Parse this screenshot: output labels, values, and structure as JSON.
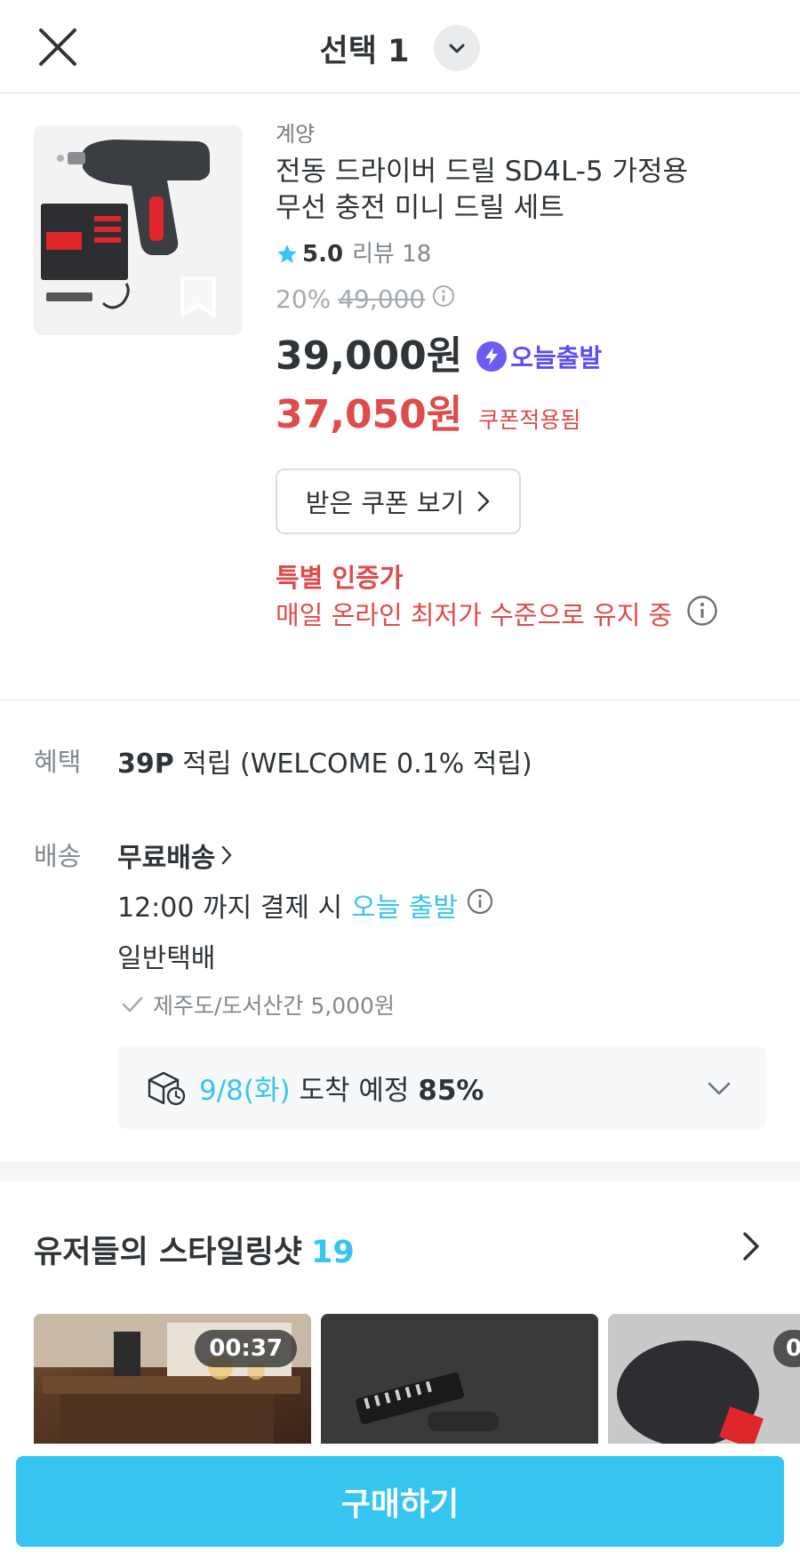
{
  "header": {
    "title": "선택 1",
    "close_icon": "close-icon",
    "dropdown_icon": "chevron-down-icon"
  },
  "product": {
    "brand": "계양",
    "name_line1": "전동 드라이버 드릴 SD4L-5 가정용",
    "name_line2": "무선 충전 미니 드릴 세트",
    "rating": "5.0",
    "review_label": "리뷰 18",
    "discount_rate": "20%",
    "original_price": "49,000",
    "price": "39,000원",
    "badge_today": "오늘출발",
    "coupon_price": "37,050원",
    "coupon_note": "쿠폰적용됨",
    "coupon_button": "받은 쿠폰 보기",
    "special_title": "특별 인증가",
    "special_desc": "매일 온라인 최저가 수준으로 유지 중"
  },
  "benefit": {
    "label": "혜택",
    "points": "39P",
    "text": " 적립 (WELCOME 0.1% 적립)"
  },
  "shipping": {
    "label": "배송",
    "method": "무료배송",
    "time_prefix": "12:00 까지 결제 시",
    "time_highlight": "오늘 출발",
    "type": "일반택배",
    "jeju_note": "제주도/도서산간 5,000원",
    "arrival_date": "9/8(화)",
    "arrival_mid": " 도착 예정 ",
    "arrival_pct": "85%"
  },
  "styling": {
    "title": "유저들의 스타일링샷",
    "count": "19",
    "shots": [
      {
        "duration": "00:37"
      },
      {
        "duration": ""
      },
      {
        "duration": "0"
      }
    ]
  },
  "buy": {
    "label": "구매하기"
  },
  "colors": {
    "accent": "#35c5f0",
    "sale_red": "#e04a4a",
    "today_purple": "#5b4cf5",
    "text": "#2f3438",
    "muted": "#82888f"
  }
}
